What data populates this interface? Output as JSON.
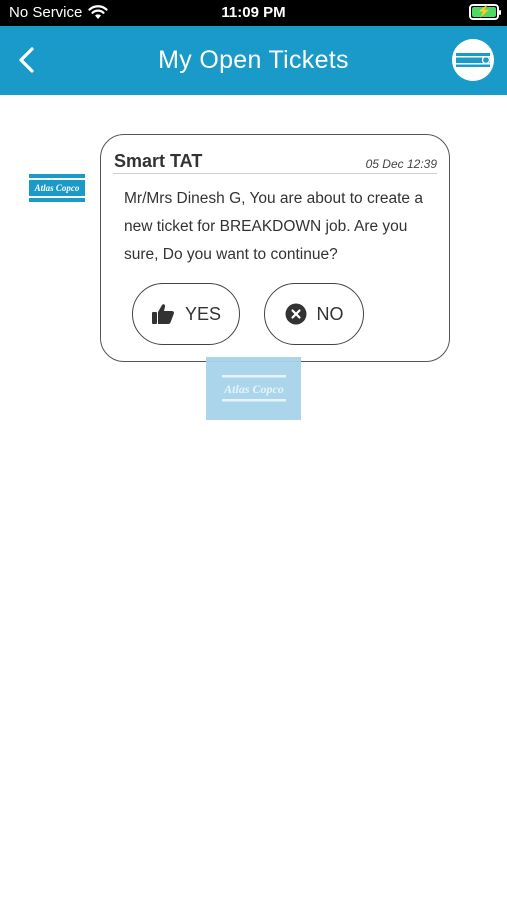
{
  "status_bar": {
    "carrier": "No Service",
    "time": "11:09 PM",
    "battery_color": "#4cd964"
  },
  "header": {
    "title": "My Open Tickets",
    "back_icon": "chevron-left-icon",
    "background": "#1a9ac9"
  },
  "chat": {
    "sender": "Smart TAT",
    "timestamp": "05 Dec 12:39",
    "message": "Mr/Mrs Dinesh G, You are about to create a new ticket for BREAKDOWN job. Are you sure, Do you want to continue?",
    "yes_label": "YES",
    "no_label": "NO"
  },
  "brand": {
    "logo_text": "Atlas Copco",
    "color": "#1a9ac9"
  }
}
